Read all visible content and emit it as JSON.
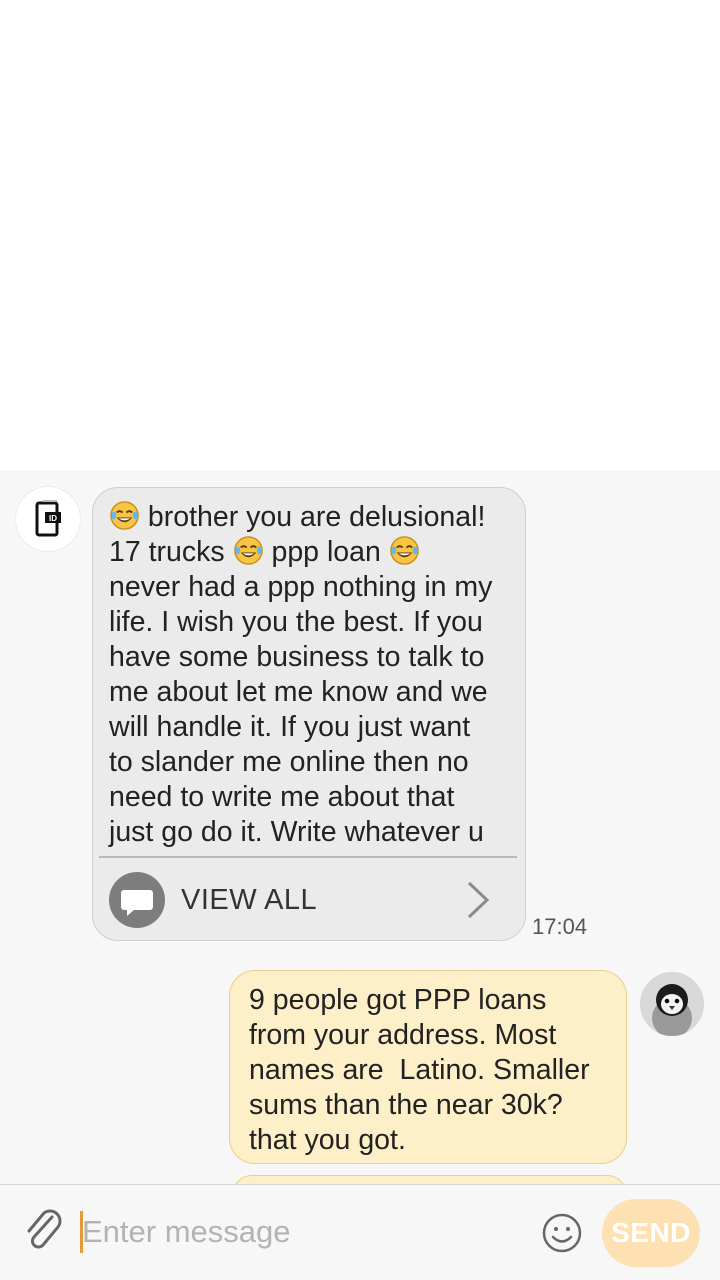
{
  "conversation": {
    "messages": [
      {
        "direction": "incoming",
        "text": "😂 brother you are delusional! 17 trucks 😂 ppp loan 😂 never had a ppp nothing in my life. I wish you the best. If you have some business to talk to me about let me know and we will handle it. If you just want to slander me online then no need to write me about that just go do it. Write whatever u",
        "line1": "brother you are delusional!",
        "line2a": "17 trucks",
        "line2b": "ppp loan",
        "rest": "never had a ppp nothing in my\nlife. I wish you the best. If you\nhave some business to talk to\nme about let me know and we\nwill handle it. If you just want\nto slander me online then no\nneed to write me about that\njust go do it. Write whatever u",
        "view_all_label": "VIEW ALL",
        "time": "17:04",
        "avatar_icon": "phone-app-logo-icon"
      },
      {
        "direction": "outgoing",
        "text": "9 people got PPP loans\nfrom your address. Most\nnames are  Latino. Smaller\nsums than the near 30k?\nthat you got.",
        "avatar_icon": "penguin-avatar-icon"
      }
    ]
  },
  "composer": {
    "placeholder": "Enter message",
    "value": "",
    "send_label": "SEND",
    "attach_icon": "paperclip-icon",
    "emoji_icon": "smiley-icon"
  },
  "colors": {
    "incoming_bubble": "#ebebeb",
    "outgoing_bubble": "#fdefc8",
    "send_button": "#fde1b3",
    "cursor": "#e39a3a"
  }
}
